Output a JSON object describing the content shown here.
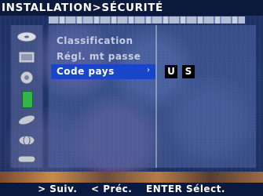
{
  "header": {
    "title": "INSTALLATION>SÉCURITÉ"
  },
  "sidebar": {
    "icons": [
      {
        "name": "disc-icon"
      },
      {
        "name": "screen-icon"
      },
      {
        "name": "speaker-icon"
      },
      {
        "name": "lock-icon",
        "active": true
      },
      {
        "name": "satellite-icon"
      },
      {
        "name": "globe-icon"
      },
      {
        "name": "remote-icon"
      }
    ]
  },
  "menu": {
    "items": [
      {
        "label": "Classification"
      },
      {
        "label": "Régl. mt passe"
      },
      {
        "label": "Code pays",
        "selected": true
      }
    ],
    "selected_arrow": "›",
    "country_code": [
      "U",
      "S"
    ]
  },
  "footer": {
    "next": "> Suiv.",
    "prev": "< Préc.",
    "enter": "ENTER Sélect."
  },
  "colors": {
    "selection": "#1746c8",
    "active_icon": "#33b54a",
    "title_bg": "#0a1838"
  }
}
